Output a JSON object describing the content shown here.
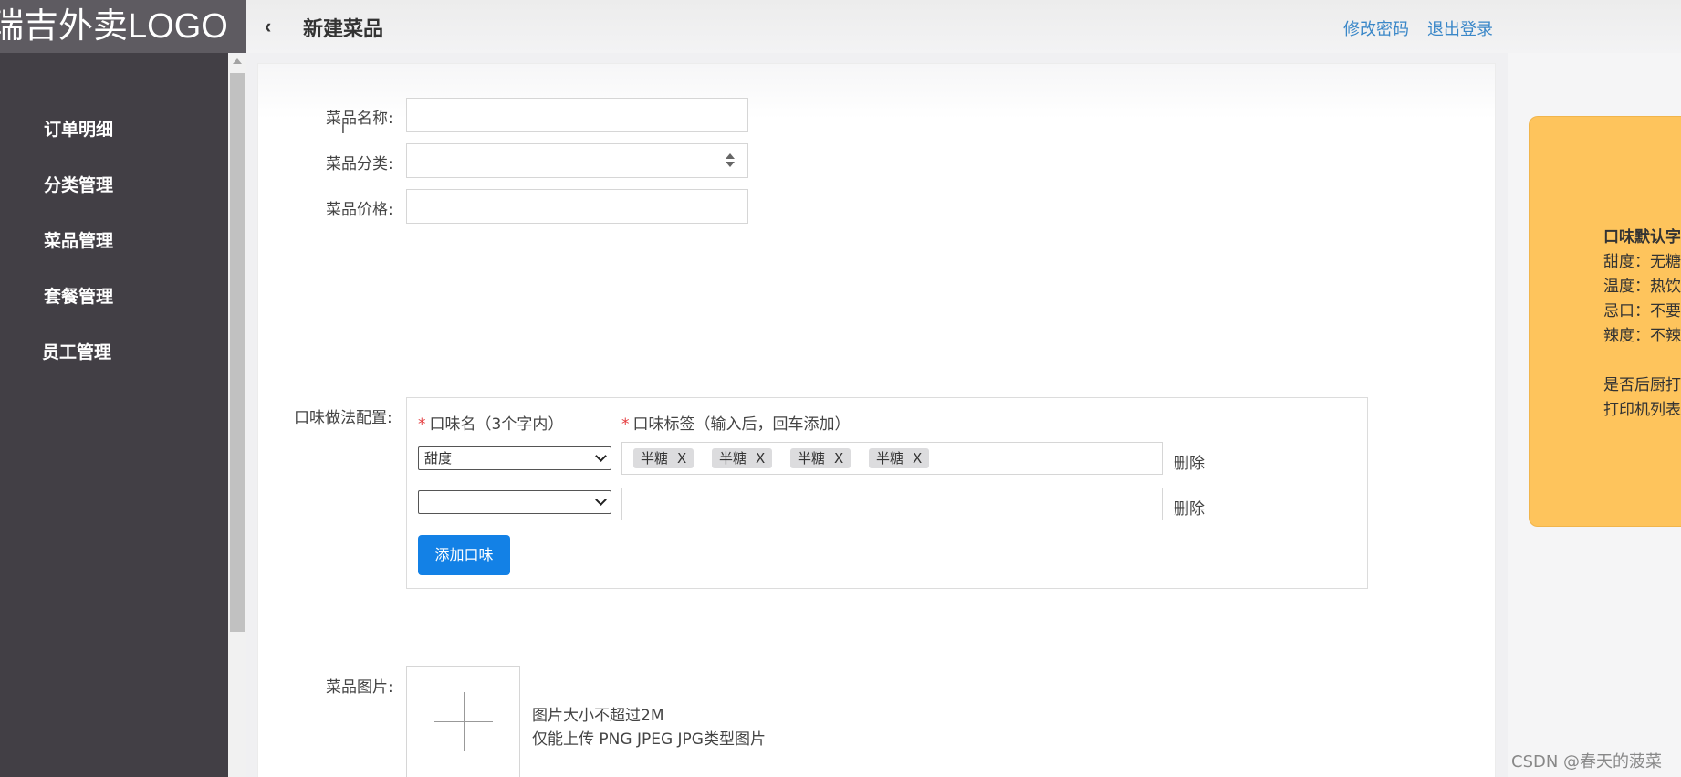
{
  "logo": "瑞吉外卖LOGO",
  "sidebar": {
    "items": [
      {
        "label": "订单明细"
      },
      {
        "label": "分类管理"
      },
      {
        "label": "菜品管理"
      },
      {
        "label": "套餐管理"
      },
      {
        "label": "员工管理"
      }
    ]
  },
  "header": {
    "back_icon": "chevron-left-icon",
    "title": "新建菜品",
    "links": {
      "change_password": "修改密码",
      "logout": "退出登录"
    }
  },
  "form": {
    "name_label": "菜品名称:",
    "name_value": "",
    "category_label": "菜品分类:",
    "category_value": "",
    "price_label": "菜品价格:",
    "price_value": "",
    "flavor_label": "口味做法配置:",
    "flavor": {
      "required_mark": "*",
      "name_header": "口味名（3个字内）",
      "tags_header": "口味标签（输入后，回车添加）",
      "rows": [
        {
          "name": "甜度",
          "tags": [
            "半糖",
            "半糖",
            "半糖",
            "半糖"
          ],
          "delete": "删除"
        },
        {
          "name": "",
          "tags": [],
          "delete": "删除"
        }
      ],
      "tag_remove": "X",
      "add_button": "添加口味"
    },
    "image_label": "菜品图片:",
    "image_hint_1": "图片大小不超过2M",
    "image_hint_2": "仅能上传 PNG JPEG JPG类型图片"
  },
  "tip": {
    "lines": [
      "口味默认字",
      "甜度：无糖",
      "温度：热饮",
      "忌口：不要",
      "辣度：不辣",
      "是否后厨打",
      "打印机列表"
    ]
  },
  "watermark": "CSDN @春天的菠菜",
  "colors": {
    "sidebar": "#423f45",
    "link": "#3a87c8",
    "primary_button": "#1381e6",
    "tip_card": "#fec45c",
    "required": "#e4393c"
  }
}
